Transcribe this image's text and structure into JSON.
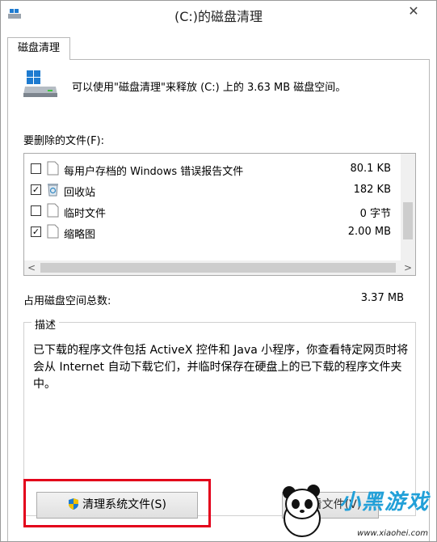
{
  "window": {
    "title": "(C:)的磁盘清理",
    "close_glyph": "✕"
  },
  "tab": {
    "label": "磁盘清理"
  },
  "intro": {
    "text": "可以使用\"磁盘清理\"来释放 (C:) 上的 3.63 MB 磁盘空间。"
  },
  "files_label": "要删除的文件(F):",
  "files": [
    {
      "name": "每用户存档的 Windows 错误报告文件",
      "size": "80.1 KB",
      "checked": false,
      "icon": "file-icon"
    },
    {
      "name": "回收站",
      "size": "182 KB",
      "checked": true,
      "icon": "recycle-bin-icon"
    },
    {
      "name": "临时文件",
      "size": "0 字节",
      "checked": false,
      "icon": "file-icon"
    },
    {
      "name": "缩略图",
      "size": "2.00 MB",
      "checked": true,
      "icon": "file-icon"
    }
  ],
  "scroll_arrows": {
    "left": "<",
    "right": ">"
  },
  "total": {
    "label": "占用磁盘空间总数:",
    "value": "3.37 MB"
  },
  "description": {
    "legend": "描述",
    "text": "已下载的程序文件包括 ActiveX 控件和 Java 小程序，你查看特定网页时将会从 Internet 自动下载它们，并临时保存在硬盘上的已下载的程序文件夹中。"
  },
  "buttons": {
    "clean_system": "清理系统文件(S)",
    "second": "查看文件(V)"
  },
  "watermark": {
    "brand": "小黑游戏",
    "url": "www.xiaohei.com"
  },
  "colors": {
    "highlight": "#e3001b",
    "accent": "#1e7bd0",
    "watermark": "#22a0d8"
  }
}
